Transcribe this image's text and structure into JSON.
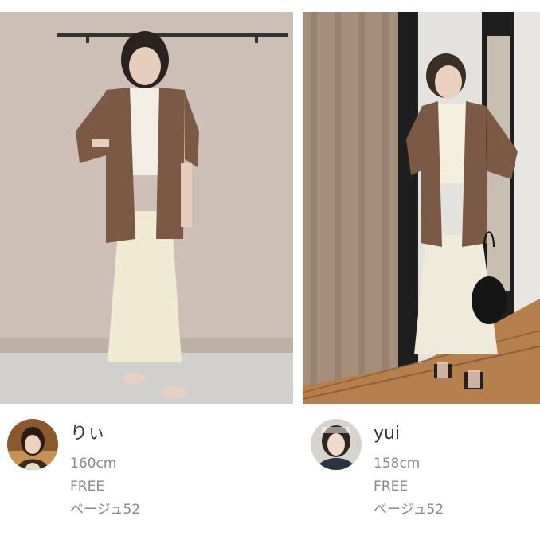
{
  "items": [
    {
      "name": "りぃ",
      "height": "160cm",
      "size": "FREE",
      "color": "ベージュ52"
    },
    {
      "name": "yui",
      "height": "158cm",
      "size": "FREE",
      "color": "ベージュ52"
    }
  ],
  "colors": {
    "jacket": "#7a5a45",
    "skirt": "#f1ead2",
    "wall_left": "#cbbcb4",
    "meta_text": "#8a8a8a"
  }
}
